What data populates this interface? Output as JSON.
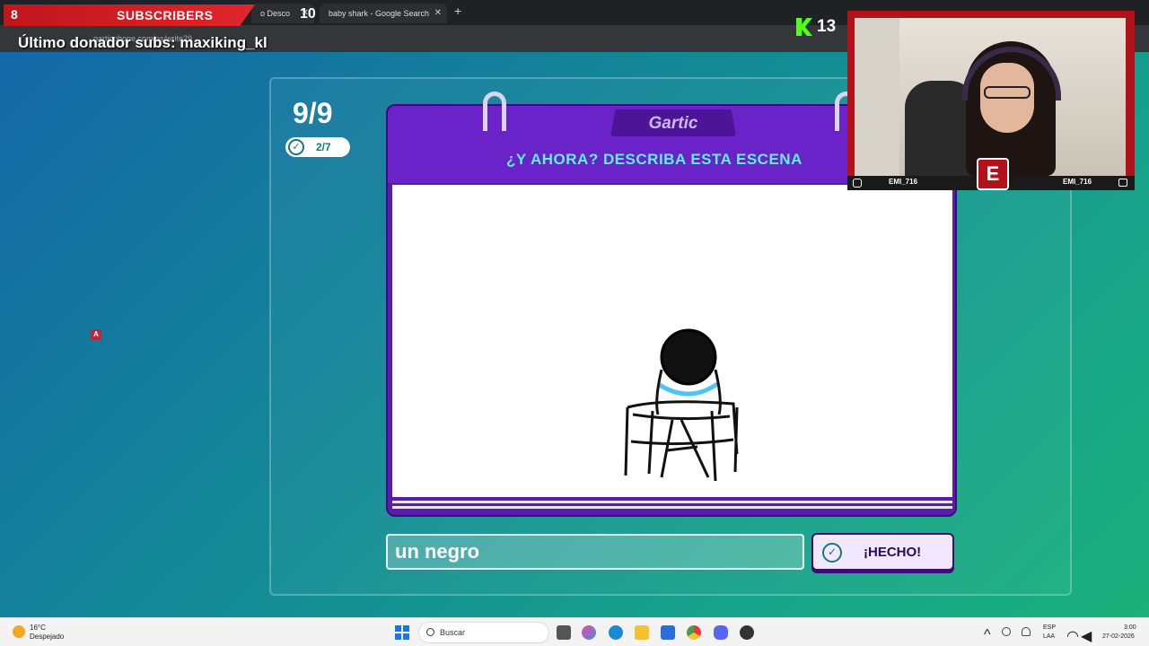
{
  "browser": {
    "tab1_title": "o Desco",
    "tab2_title": "baby shark - Google Search",
    "tab_close": "✕",
    "new_tab": "+",
    "url": "garticphone.com/es/write29"
  },
  "overlay": {
    "sub_count_left": "8",
    "sub_label": "SUBSCRIBERS",
    "sub_count_right": "10",
    "donor_text": "Último donador subs: maxiking_kl",
    "kick_count": "13"
  },
  "webcam": {
    "name_left": "EMI_716",
    "name_right": "EMI_716",
    "logo": "E"
  },
  "game": {
    "round": "9/9",
    "progress": "2/7",
    "logo": "Gartic",
    "prompt": "¿Y AHORA? DESCRIBA ESTA ESCENA",
    "answer_value": "un negro",
    "done_label": "¡HECHO!",
    "badge": "A"
  },
  "colors": {
    "accent_purple": "#6a23c8",
    "prompt_cyan": "#5ef0e0",
    "stream_red": "#c0161c",
    "kick_green": "#53fc18"
  },
  "icons": {
    "check": "check-circle-icon",
    "kick": "kick-logo-icon",
    "instagram": "instagram-icon",
    "chat": "chat-icon",
    "windows": "windows-start-icon",
    "search": "search-icon"
  },
  "taskbar": {
    "weather_temp": "16°C",
    "weather_desc": "Despejado",
    "search_label": "Buscar",
    "lang_top": "ESP",
    "lang_bottom": "LAA",
    "time": "3:00",
    "date": "27-02-2026"
  }
}
